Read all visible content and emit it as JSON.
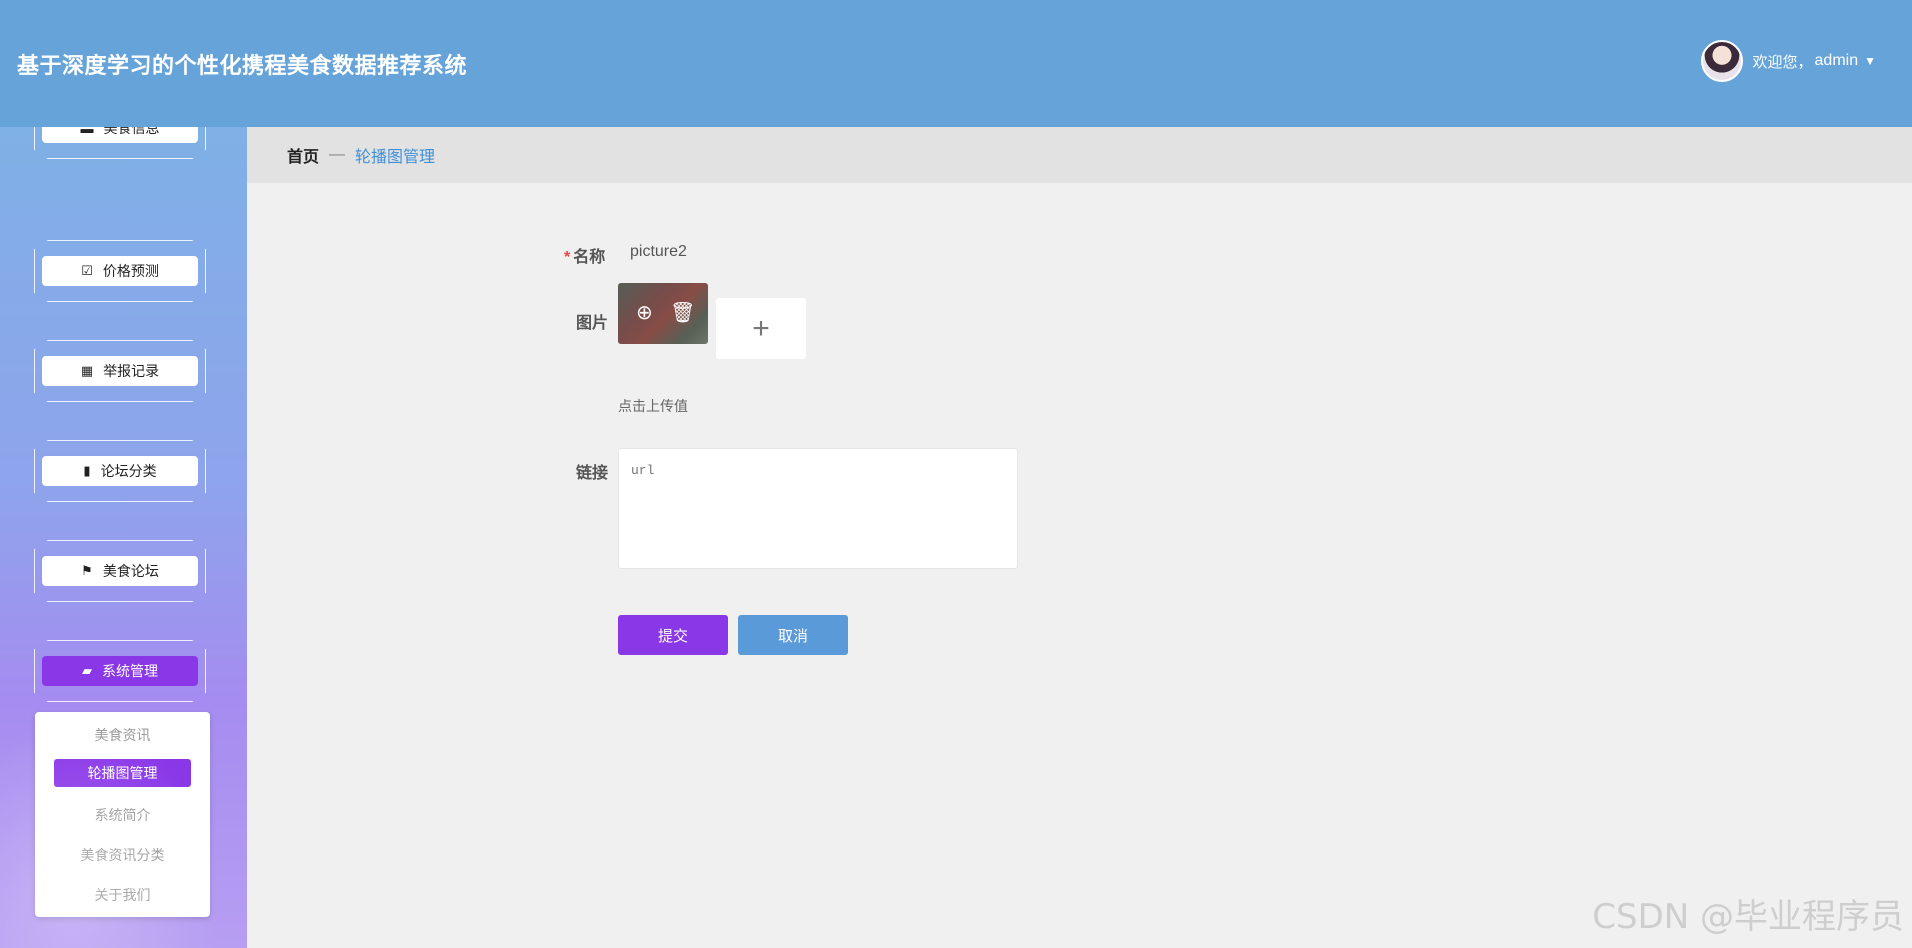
{
  "header": {
    "app_title": "基于深度学习的个性化携程美食数据推荐系统",
    "welcome": "欢迎您，",
    "username": "admin",
    "caret": "▼"
  },
  "sidebar": {
    "items": [
      {
        "label": "美食信息",
        "icon": "list-icon"
      },
      {
        "label": "价格预测",
        "icon": "clipboard-check-icon"
      },
      {
        "label": "举报记录",
        "icon": "grid-icon"
      },
      {
        "label": "论坛分类",
        "icon": "bar-chart-icon"
      },
      {
        "label": "美食论坛",
        "icon": "flag-icon"
      },
      {
        "label": "系统管理",
        "icon": "briefcase-icon"
      }
    ],
    "icons": [
      "▬",
      "☑",
      "▦",
      "▮",
      "⚑",
      "▰"
    ],
    "submenu": [
      "美食资讯",
      "轮播图管理",
      "系统简介",
      "美食资讯分类",
      "关于我们"
    ]
  },
  "breadcrumb": {
    "home": "首页",
    "separator": "—",
    "current": "轮播图管理"
  },
  "form": {
    "name_label": "名称",
    "required_mark": "*",
    "name_value": "picture2",
    "image_label": "图片",
    "upload_plus": "+",
    "upload_hint": "点击上传值",
    "link_label": "链接",
    "link_placeholder": "url",
    "submit_label": "提交",
    "cancel_label": "取消"
  },
  "watermark": "CSDN @毕业程序员",
  "colors": {
    "header_bg": "#66a3d9",
    "accent_purple": "#8a37e8",
    "cancel_blue": "#5b9ad8",
    "breadcrumb_link": "#3f8fd9"
  }
}
